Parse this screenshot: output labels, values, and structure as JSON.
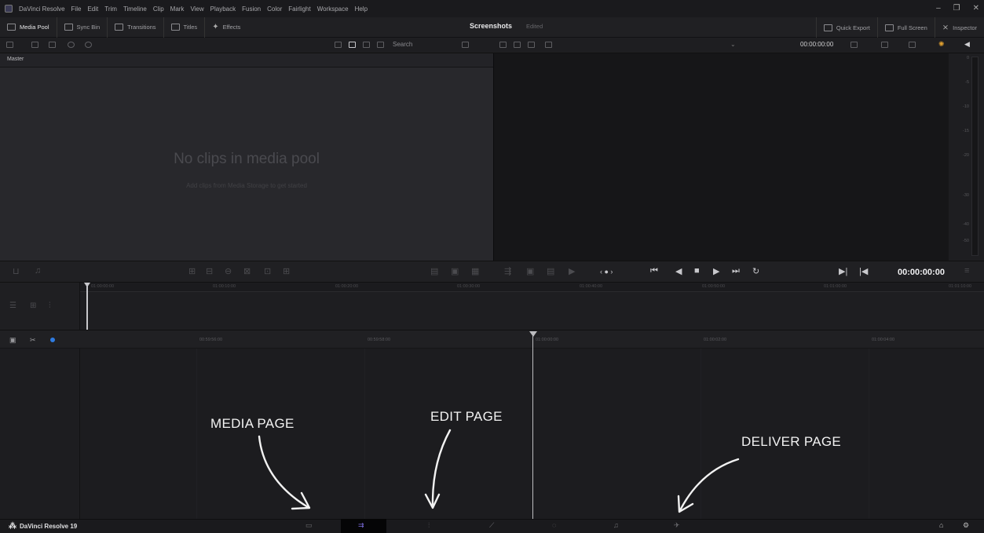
{
  "menubar": {
    "app_name": "DaVinci Resolve",
    "items": [
      "File",
      "Edit",
      "Trim",
      "Timeline",
      "Clip",
      "Mark",
      "View",
      "Playback",
      "Fusion",
      "Color",
      "Fairlight",
      "Workspace",
      "Help"
    ],
    "controls": [
      "–",
      "❐",
      "✕"
    ]
  },
  "toolbar": {
    "media_pool": "Media Pool",
    "sync_bin": "Sync Bin",
    "transitions": "Transitions",
    "titles": "Titles",
    "effects": "Effects",
    "project_title": "Screenshots",
    "project_status": "Edited",
    "quick_export": "Quick Export",
    "full_screen": "Full Screen",
    "inspector": "Inspector"
  },
  "search": {
    "placeholder": "Search"
  },
  "viewer": {
    "timecode": "00:00:00:00"
  },
  "media_pool": {
    "bin_name": "Master",
    "empty_title": "No clips in media pool",
    "empty_subtitle": "Add clips from Media Storage to get started"
  },
  "audio_meter": {
    "scale": [
      "0",
      "-5",
      "-10",
      "-15",
      "-20",
      "-30",
      "-40",
      "-50"
    ]
  },
  "transport": {
    "timecode": "00:00:00:00"
  },
  "upper_ruler": [
    "01:00:00:00",
    "01:00:10:00",
    "01:00:20:00",
    "01:00:30:00",
    "01:00:40:00",
    "01:00:50:00",
    "01:01:00:00",
    "01:01:10:00"
  ],
  "lower_ruler": [
    "00:59:56:00",
    "00:59:58:00",
    "01:00:00:00",
    "01:00:02:00",
    "01:00:04:00"
  ],
  "annotations": {
    "media": "MEDIA PAGE",
    "edit": "EDIT PAGE",
    "deliver": "DELIVER PAGE"
  },
  "pagebar": {
    "brand": "DaVinci Resolve 19",
    "pages": [
      "media-page-icon",
      "cut-page-icon",
      "edit-page-icon",
      "fusion-page-icon",
      "color-page-icon",
      "fairlight-page-icon",
      "deliver-page-icon"
    ],
    "active_page": "edit"
  }
}
